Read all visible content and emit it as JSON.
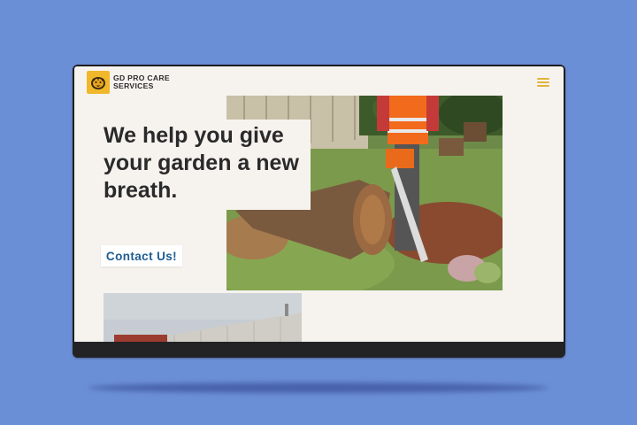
{
  "header": {
    "brand_line1": "GD PRO CARE",
    "brand_line2": "SERVICES",
    "logo_icon": "tiger-logo-icon",
    "menu_icon": "hamburger-menu-icon"
  },
  "hero": {
    "headline": "We help you give your garden a new breath.",
    "cta_label": "Contact Us!",
    "image": "worker-with-chainsaw-cutting-tree-stump"
  },
  "secondary": {
    "image": "industrial-building-exterior"
  },
  "colors": {
    "background": "#6b8fd6",
    "page": "#f6f3ef",
    "accent": "#f0b72a",
    "cta_text": "#1d5c92",
    "headline": "#2a2a2a"
  }
}
